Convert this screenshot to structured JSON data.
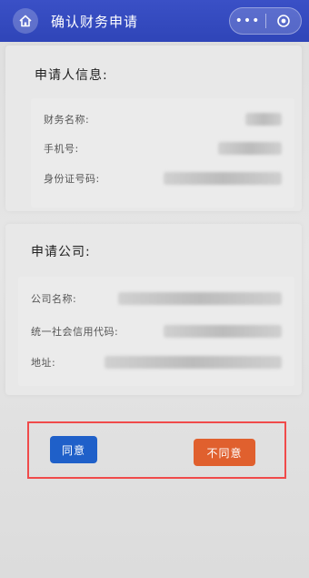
{
  "header": {
    "title": "确认财务申请",
    "more_label": "•••"
  },
  "applicant": {
    "section_title": "申请人信息:",
    "fields": [
      {
        "label": "财务名称:"
      },
      {
        "label": "手机号:"
      },
      {
        "label": "身份证号码:"
      }
    ]
  },
  "company": {
    "section_title": "申请公司:",
    "fields": [
      {
        "label": "公司名称:"
      },
      {
        "label": "统一社会信用代码:"
      },
      {
        "label": "地址:"
      }
    ]
  },
  "actions": {
    "agree_label": "同意",
    "disagree_label": "不同意"
  },
  "colors": {
    "header_bg": "#2f45b8",
    "agree_bg": "#1f60c9",
    "disagree_bg": "#e0602e",
    "highlight_border": "#f04a4a"
  }
}
